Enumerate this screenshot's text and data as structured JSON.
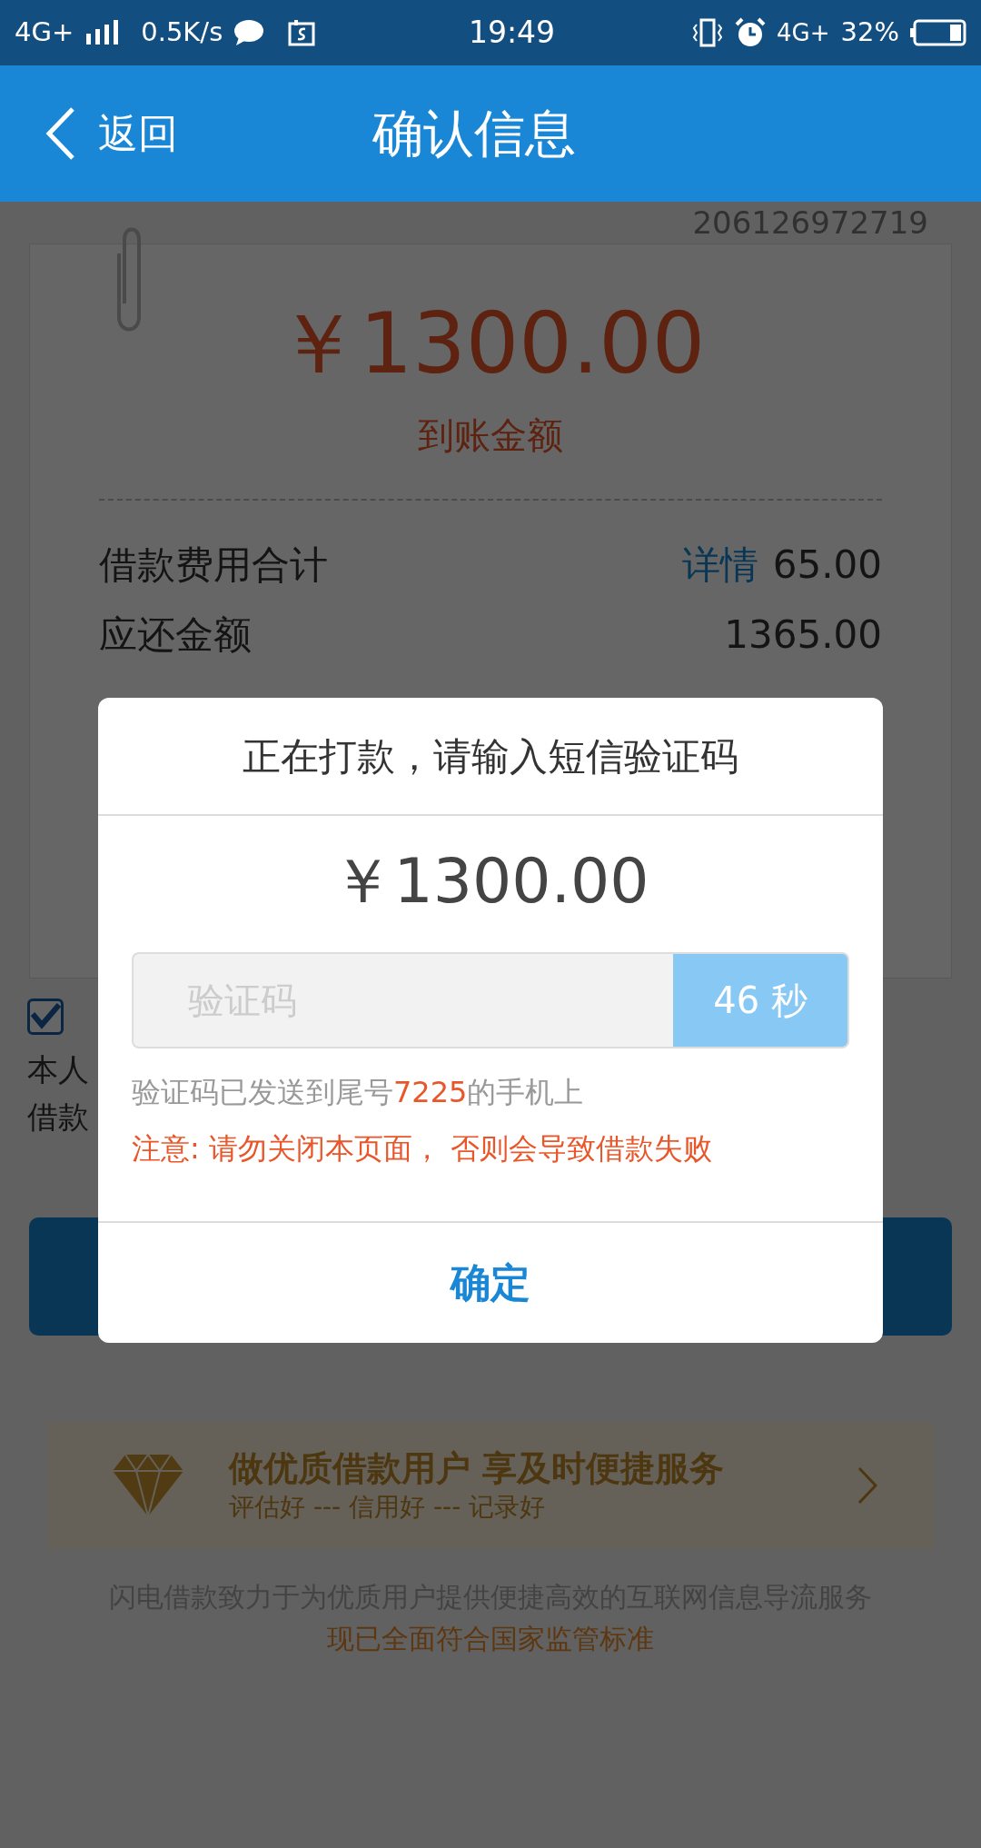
{
  "status_bar": {
    "network": "4G+",
    "speed": "0.5K/s",
    "time": "19:49",
    "network_2": "4G+",
    "battery": "32%"
  },
  "header": {
    "back": "返回",
    "title": "确认信息"
  },
  "order_number": "206126972719",
  "summary": {
    "amount": "￥1300.00",
    "amount_label": "到账金额",
    "rows": [
      {
        "label": "借款费用合计",
        "link": "详情",
        "value": "65.00"
      },
      {
        "label": "应还金额",
        "value": "1365.00"
      }
    ]
  },
  "agreement": {
    "checked": true,
    "lines": [
      "本人",
      "借款"
    ]
  },
  "banner": {
    "title": "做优质借款用户 享及时便捷服务",
    "subtitle": "评估好 --- 信用好 --- 记录好"
  },
  "footer": [
    "闪电借款致力于为优质用户提供便捷高效的互联网信息导流服务",
    "现已全面符合国家监管标准"
  ],
  "dialog": {
    "title": "正在打款，请输入短信验证码",
    "amount": "￥1300.00",
    "code_placeholder": "验证码",
    "countdown": "46 秒",
    "notice_before": "验证码已发送到尾号",
    "notice_number": "7225",
    "notice_after": "的手机上",
    "warning": "注意: 请勿关闭本页面， 否则会导致借款失败",
    "confirm": "确定"
  }
}
